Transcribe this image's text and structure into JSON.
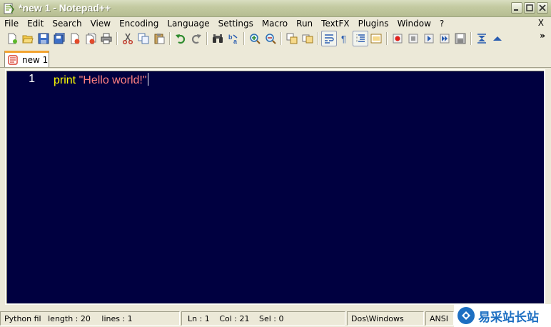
{
  "window": {
    "title": "*new  1 - Notepad++"
  },
  "menu": {
    "items": [
      {
        "label": "File"
      },
      {
        "label": "Edit"
      },
      {
        "label": "Search"
      },
      {
        "label": "View"
      },
      {
        "label": "Encoding"
      },
      {
        "label": "Language"
      },
      {
        "label": "Settings"
      },
      {
        "label": "Macro"
      },
      {
        "label": "Run"
      },
      {
        "label": "TextFX"
      },
      {
        "label": "Plugins"
      },
      {
        "label": "Window"
      },
      {
        "label": "?"
      }
    ],
    "close_label": "X"
  },
  "toolbar": {
    "overflow_label": "»",
    "icons": [
      "new-file-icon",
      "open-file-icon",
      "save-icon",
      "save-all-icon",
      "close-icon",
      "close-all-icon",
      "print-icon",
      "cut-icon",
      "copy-icon",
      "paste-icon",
      "undo-icon",
      "redo-icon",
      "find-icon",
      "replace-icon",
      "zoom-in-icon",
      "zoom-out-icon",
      "sync-vertical-icon",
      "sync-horizontal-icon",
      "word-wrap-icon",
      "show-all-chars-icon",
      "indent-guide-icon",
      "doc-map-icon",
      "record-macro-icon",
      "stop-record-icon",
      "play-macro-icon",
      "run-macro-multiple-icon",
      "save-macro-icon",
      "fold-all-icon",
      "unfold-icon"
    ]
  },
  "tabs": [
    {
      "label": "new  1",
      "modified": true
    }
  ],
  "editor": {
    "lines": [
      {
        "number": "1",
        "keyword": "print",
        "space": " ",
        "string": "\"Hello world!\""
      }
    ],
    "colors": {
      "background": "#000040",
      "keyword": "#ffff00",
      "string": "#ff8080",
      "line_number": "#ffffff"
    }
  },
  "status": {
    "language": "Python fil",
    "length": "length : 20",
    "lines": "lines : 1",
    "ln": "Ln : 1",
    "col": "Col : 21",
    "sel": "Sel : 0",
    "eol": "Dos\\Windows",
    "encoding": "ANSI"
  },
  "watermark": {
    "text": "易采站长站"
  }
}
